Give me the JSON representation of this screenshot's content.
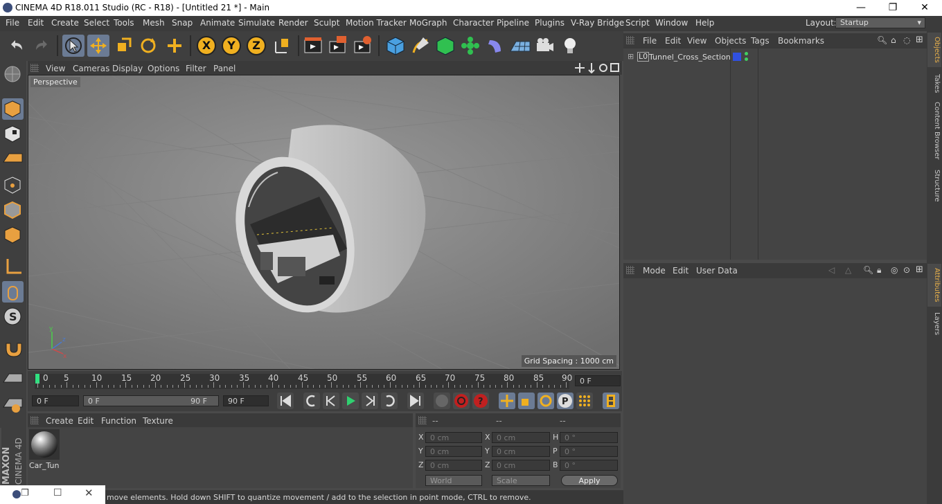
{
  "window": {
    "title": "CINEMA 4D R18.011 Studio (RC - R18) - [Untitled 21 *] - Main",
    "controls": [
      "—",
      "❐",
      "✕"
    ]
  },
  "menu": [
    "File",
    "Edit",
    "Create",
    "Select",
    "Tools",
    "Mesh",
    "Snap",
    "Animate",
    "Simulate",
    "Render",
    "Sculpt",
    "Motion Tracker",
    "MoGraph",
    "Character",
    "Pipeline",
    "Plugins",
    "V-Ray Bridge",
    "Script",
    "Window",
    "Help"
  ],
  "layout": {
    "label": "Layout:",
    "value": "Startup"
  },
  "toolbar": {
    "axis_x": "X",
    "axis_y": "Y",
    "axis_z": "Z"
  },
  "viewport": {
    "menu": [
      "View",
      "Cameras",
      "Display",
      "Options",
      "Filter",
      "Panel"
    ],
    "label": "Perspective",
    "grid_spacing": "Grid Spacing : 1000 cm"
  },
  "timeline": {
    "ticks": [
      "0",
      "5",
      "10",
      "15",
      "20",
      "25",
      "30",
      "35",
      "40",
      "45",
      "50",
      "55",
      "60",
      "65",
      "70",
      "75",
      "80",
      "85",
      "90"
    ],
    "current_frame": "0 F",
    "start_field": "0 F",
    "range_start": "0 F",
    "range_end": "90 F",
    "end_field": "90 F"
  },
  "materials": {
    "menu": [
      "Create",
      "Edit",
      "Function",
      "Texture"
    ],
    "items": [
      {
        "name": "Car_Tun"
      }
    ]
  },
  "coordinates": {
    "headers": [
      "--",
      "--",
      "--"
    ],
    "rows": [
      {
        "a_label": "X",
        "a_val": "0 cm",
        "b_label": "X",
        "b_val": "0 cm",
        "c_label": "H",
        "c_val": "0 °"
      },
      {
        "a_label": "Y",
        "a_val": "0 cm",
        "b_label": "Y",
        "b_val": "0 cm",
        "c_label": "P",
        "c_val": "0 °"
      },
      {
        "a_label": "Z",
        "a_val": "0 cm",
        "b_label": "Z",
        "b_val": "0 cm",
        "c_label": "B",
        "c_val": "0 °"
      }
    ],
    "space": "World",
    "mode": "Scale",
    "apply": "Apply"
  },
  "objects": {
    "menu": [
      "File",
      "Edit",
      "View",
      "Objects",
      "Tags",
      "Bookmarks"
    ],
    "items": [
      {
        "name": "Tunnel_Cross_Section"
      }
    ]
  },
  "attributes": {
    "menu": [
      "Mode",
      "Edit",
      "User Data"
    ]
  },
  "right_tabs": [
    "Objects",
    "Takes",
    "Content Browser",
    "Structure",
    "Attributes",
    "Layers"
  ],
  "status": "move elements. Hold down SHIFT to quantize movement / add to the selection in point mode, CTRL to remove.",
  "branding": {
    "maxon": "MAXON",
    "product": "CINEMA 4D"
  },
  "colors": {
    "accent": "#6b7b94",
    "tab_active": "#e8b04a",
    "obj_tag_blue": "#3050e0",
    "obj_tag_green": "#40d060"
  }
}
